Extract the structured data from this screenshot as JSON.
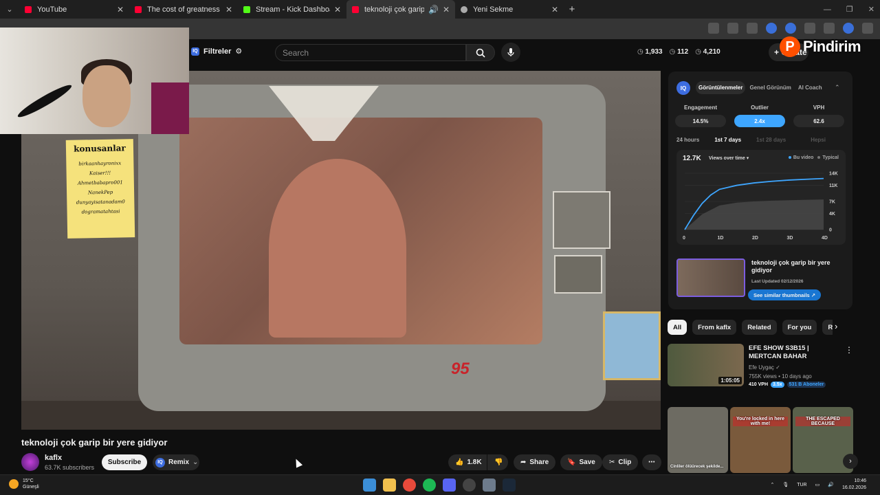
{
  "browser": {
    "tabs": [
      {
        "title": "YouTube",
        "color": "#ff0033"
      },
      {
        "title": "The cost of greatness - YouTub",
        "color": "#ff0033"
      },
      {
        "title": "Stream - Kick Dashboard",
        "color": "#53fc18"
      },
      {
        "title": "teknoloji çok garip bir yere",
        "color": "#ff0033",
        "active": true
      },
      {
        "title": "Yeni Sekme",
        "color": "#aaaaaa"
      }
    ]
  },
  "header": {
    "filters_label": "Filtreler",
    "search_placeholder": "Search",
    "stats": [
      "1,933",
      "112",
      "4,210"
    ],
    "create_label": "+ Create"
  },
  "brand": {
    "initial": "P",
    "name": "Pindirim"
  },
  "overlay": {
    "note_title": "konusanlar",
    "note_names": [
      "birkaanhayronixx",
      "Kaiser!!!",
      "Ahmetbabapro001",
      "NanekPep",
      "dunyayisatanadam0",
      "dogramatahtasi"
    ],
    "sticker": "95"
  },
  "video": {
    "title": "teknoloji çok garip bir yere gidiyor",
    "channel": "kaflx",
    "subscribers": "63.7K subscribers",
    "subscribe_label": "Subscribe",
    "remix_label": "Remix",
    "likes": "1.8K",
    "share_label": "Share",
    "save_label": "Save",
    "clip_label": "Clip"
  },
  "iq_panel": {
    "logo": "IQ",
    "tabs": [
      "Görüntülenmeler",
      "Genel Görünüm",
      "AI Coach"
    ],
    "metrics": [
      {
        "label": "Engagement",
        "value": "14.5%"
      },
      {
        "label": "Outlier",
        "value": "2.4x",
        "highlight": true
      },
      {
        "label": "VPH",
        "value": "62.6"
      }
    ],
    "ranges": [
      "24 hours",
      "1st 7 days",
      "1st 28 days",
      "Hepsi"
    ],
    "active_range": "1st 7 days",
    "views_total": "12.7K",
    "views_selector": "Views over time ▾",
    "legend": [
      {
        "label": "Bu video",
        "color": "#3ea6ff"
      },
      {
        "label": "Typical",
        "color": "#777777"
      }
    ],
    "thumb_title": "teknoloji çok garip bir yere gidiyor",
    "last_updated": "Last Updated 02/12/2026",
    "similar_btn": "See similar thumbnails ↗"
  },
  "chart_data": {
    "type": "area",
    "x_ticks": [
      "0",
      "1D",
      "2D",
      "3D",
      "4D"
    ],
    "y_ticks": [
      "0",
      "4K",
      "7K",
      "11K",
      "14K"
    ],
    "ylim": [
      0,
      14000
    ],
    "xlim": [
      0,
      4
    ],
    "series": [
      {
        "name": "Bu video",
        "x": [
          0,
          0.25,
          0.5,
          0.75,
          1,
          1.5,
          2,
          2.5,
          3,
          3.5,
          4
        ],
        "values": [
          0,
          3500,
          6500,
          8600,
          10000,
          11000,
          11600,
          12000,
          12300,
          12500,
          12700
        ]
      },
      {
        "name": "Typical",
        "x": [
          0,
          0.5,
          1,
          1.5,
          2,
          2.5,
          3,
          3.5,
          4
        ],
        "values": [
          0,
          3800,
          6000,
          6700,
          7000,
          7200,
          7300,
          7400,
          7500
        ]
      }
    ]
  },
  "chips": [
    "All",
    "From kaflx",
    "Related",
    "For you",
    "Rece"
  ],
  "recommended": {
    "title": "EFE SHOW S3B15 | MERTCAN BAHAR",
    "channel": "Efe Uygaç ✓",
    "meta": "755K views • 10 days ago",
    "duration": "1:05:05",
    "vph": "410 VPH",
    "outlier": "3.5x",
    "subs": "531 B Aboneler"
  },
  "shorts": [
    {
      "caption_top": "",
      "caption_bottom": "Cinliler ölüürecek şekilde...",
      "color": "#6d6b62"
    },
    {
      "caption_top": "You're locked in here with me!",
      "caption_bottom": "",
      "color": "#7a5a3c"
    },
    {
      "caption_top": "THE ESCAPED BECAUSE",
      "caption_bottom": "",
      "color": "#59614b"
    }
  ],
  "taskbar": {
    "temp": "15°C",
    "location": "Güneşli",
    "lang": "TUR",
    "time": "10:46",
    "date": "16.02.2026"
  }
}
